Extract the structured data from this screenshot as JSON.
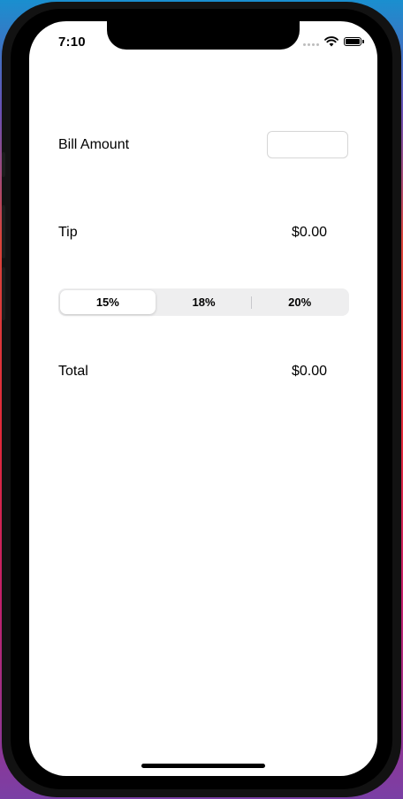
{
  "status_bar": {
    "time": "7:10",
    "icons": [
      "signal-icon",
      "wifi-icon",
      "battery-icon"
    ]
  },
  "bill": {
    "label": "Bill Amount",
    "input_value": "",
    "placeholder": ""
  },
  "tip": {
    "label": "Tip",
    "value": "$0.00"
  },
  "tip_control": {
    "segments": [
      "15%",
      "18%",
      "20%"
    ],
    "selected": "15%"
  },
  "total": {
    "label": "Total",
    "value": "$0.00"
  }
}
